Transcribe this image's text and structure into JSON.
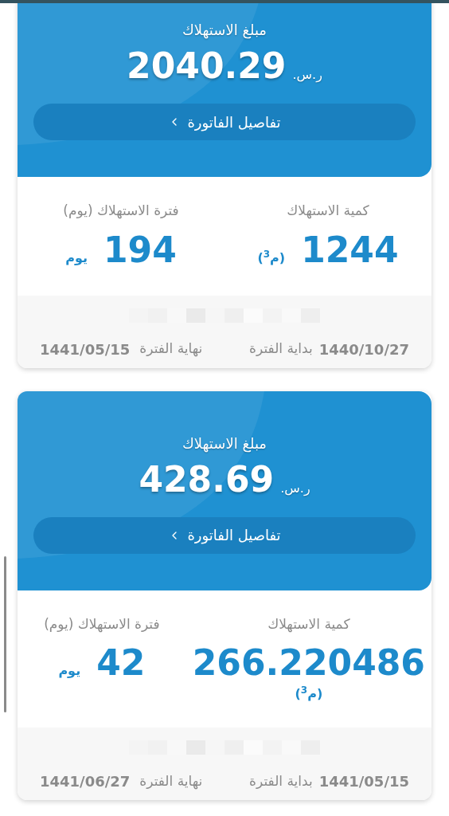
{
  "bills": [
    {
      "amount_label": "مبلغ الاستهلاك",
      "amount": "2040.29",
      "currency": "ر.س.",
      "details_button": "تفاصيل الفاتورة",
      "quantity": {
        "label": "كمية الاستهلاك",
        "value": "1244",
        "unit": "(م$^{3}$)"
      },
      "period": {
        "label": "فترة الاستهلاك (يوم)",
        "value": "194",
        "unit": "يوم"
      },
      "start": {
        "label": "بداية الفترة",
        "date": "1440/10/27"
      },
      "end": {
        "label": "نهاية الفترة",
        "date": "1441/05/15"
      }
    },
    {
      "amount_label": "مبلغ الاستهلاك",
      "amount": "428.69",
      "currency": "ر.س.",
      "details_button": "تفاصيل الفاتورة",
      "quantity": {
        "label": "كمية الاستهلاك",
        "value": "266.220486",
        "unit": "(م$^{3}$)"
      },
      "period": {
        "label": "فترة الاستهلاك (يوم)",
        "value": "42",
        "unit": "يوم"
      },
      "start": {
        "label": "بداية الفترة",
        "date": "1441/05/15"
      },
      "end": {
        "label": "نهاية الفترة",
        "date": "1441/06/27"
      }
    }
  ]
}
